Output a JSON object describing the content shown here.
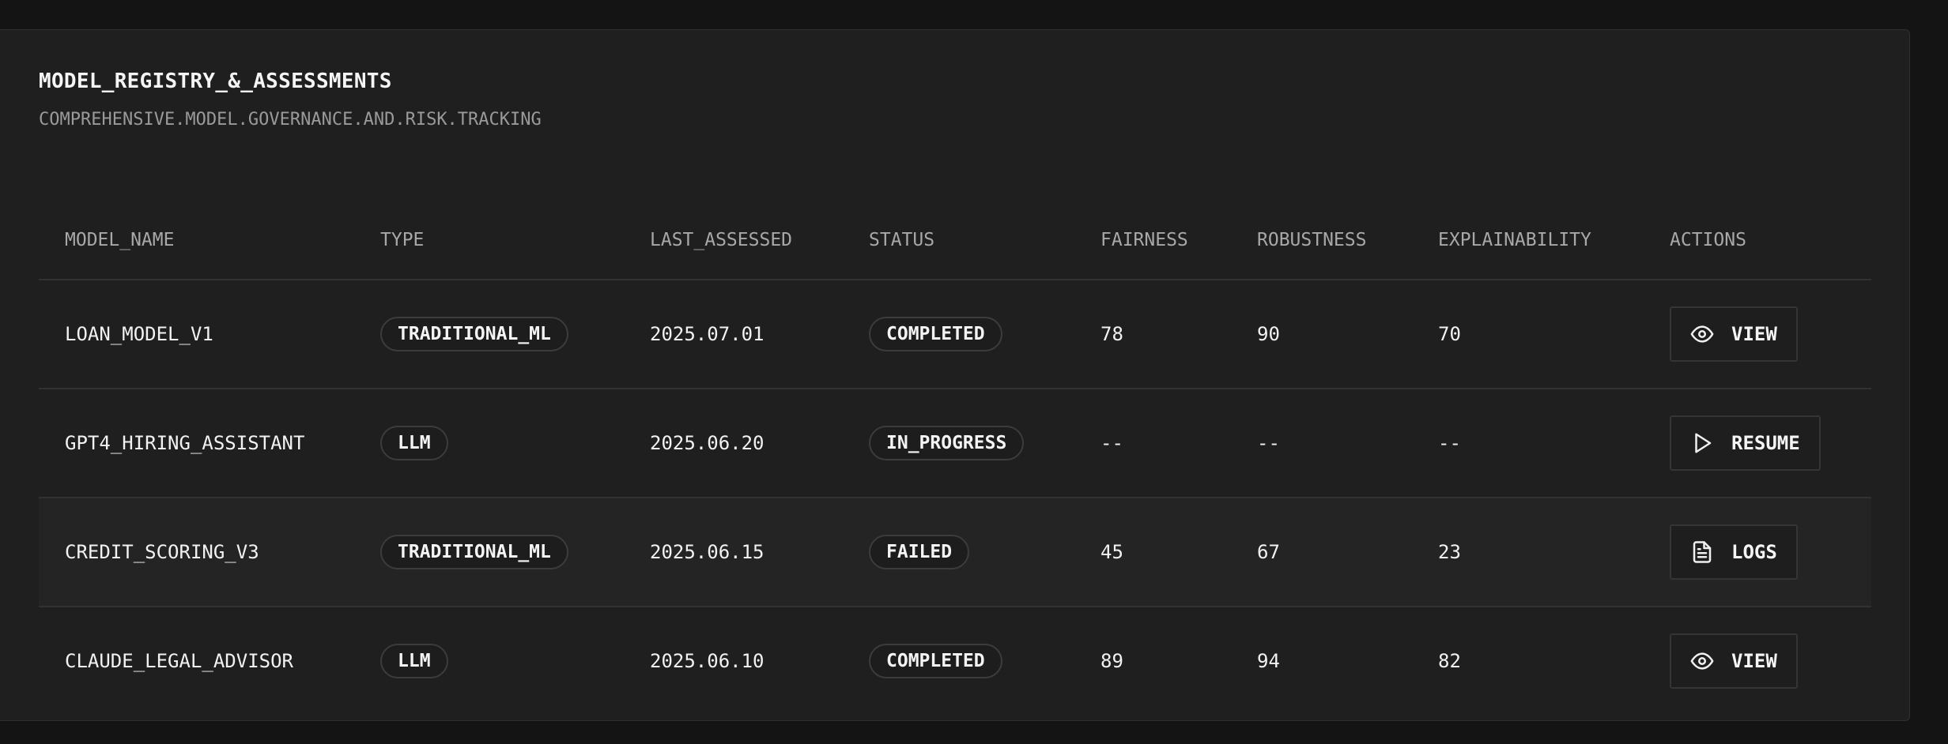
{
  "header": {
    "title": "MODEL_REGISTRY_&_ASSESSMENTS",
    "subtitle": "COMPREHENSIVE.MODEL.GOVERNANCE.AND.RISK.TRACKING"
  },
  "table": {
    "columns": [
      "MODEL_NAME",
      "TYPE",
      "LAST_ASSESSED",
      "STATUS",
      "FAIRNESS",
      "ROBUSTNESS",
      "EXPLAINABILITY",
      "ACTIONS"
    ],
    "rows": [
      {
        "model_name": "LOAN_MODEL_V1",
        "type": "TRADITIONAL_ML",
        "last_assessed": "2025.07.01",
        "status": "COMPLETED",
        "fairness": "78",
        "robustness": "90",
        "explainability": "70",
        "action_label": "VIEW",
        "action_icon": "eye-icon"
      },
      {
        "model_name": "GPT4_HIRING_ASSISTANT",
        "type": "LLM",
        "last_assessed": "2025.06.20",
        "status": "IN_PROGRESS",
        "fairness": "--",
        "robustness": "--",
        "explainability": "--",
        "action_label": "RESUME",
        "action_icon": "play-icon"
      },
      {
        "model_name": "CREDIT_SCORING_V3",
        "type": "TRADITIONAL_ML",
        "last_assessed": "2025.06.15",
        "status": "FAILED",
        "fairness": "45",
        "robustness": "67",
        "explainability": "23",
        "action_label": "LOGS",
        "action_icon": "document-icon"
      },
      {
        "model_name": "CLAUDE_LEGAL_ADVISOR",
        "type": "LLM",
        "last_assessed": "2025.06.10",
        "status": "COMPLETED",
        "fairness": "89",
        "robustness": "94",
        "explainability": "82",
        "action_label": "VIEW",
        "action_icon": "eye-icon"
      }
    ]
  }
}
